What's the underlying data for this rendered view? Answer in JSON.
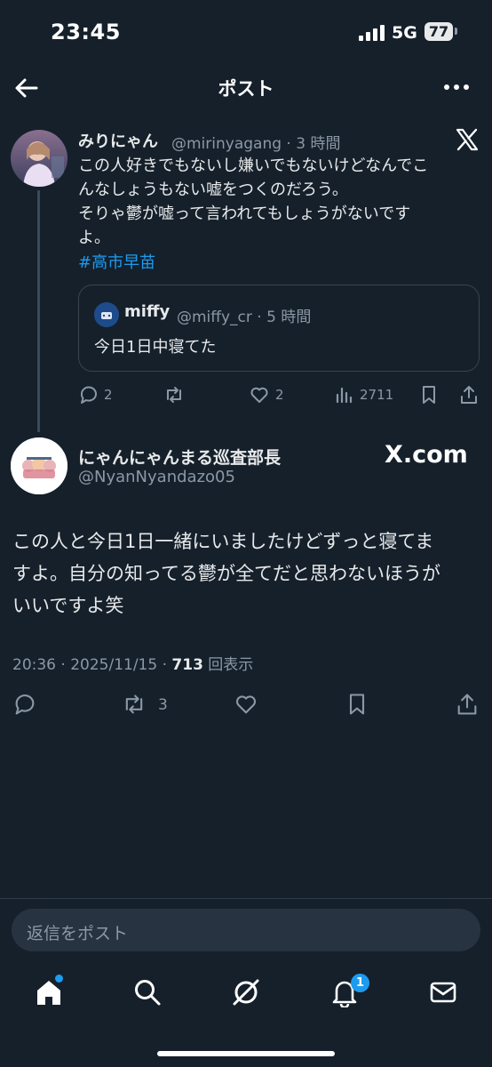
{
  "status_bar": {
    "time": "23:45",
    "network": "5G",
    "battery": "77"
  },
  "header": {
    "title": "ポスト"
  },
  "parent_tweet": {
    "name": "みりにゃん",
    "handle_time": "@mirinyagang · 3 時間",
    "text_lines": [
      "この人好きでもないし嫌いでもないけどなんでこ",
      "んなしょうもない嘘をつくのだろう。",
      "そりゃ鬱が嘘って言われてもしょうがないです",
      "よ。"
    ],
    "hashtag": "#高市早苗",
    "quote": {
      "name": "miffy",
      "handle_time": "@miffy_cr · 5 時間",
      "text": "今日1日中寝てた"
    },
    "actions": {
      "replies": "2",
      "retweets": "",
      "likes": "2",
      "views": "2711"
    }
  },
  "main_tweet": {
    "name": "にゃんにゃんまる巡査部長",
    "handle": "@NyanNyandazo05",
    "watermark": "X.com",
    "text_lines": [
      "この人と今日1日一緒にいましたけどずっと寝てま",
      "すよ。自分の知ってる鬱が全てだと思わないほうが",
      "いいですよ笑"
    ],
    "meta": {
      "datetime": "20:36 · 2025/11/15 · ",
      "views": "713",
      "views_label": " 回表示"
    },
    "actions": {
      "retweets": "3"
    }
  },
  "reply": {
    "placeholder": "返信をポスト"
  },
  "bottom_nav": {
    "items": [
      "home-icon",
      "search-icon",
      "grok-icon",
      "notifications-icon",
      "messages-icon"
    ],
    "notification_count": "1"
  },
  "colors": {
    "background": "#15202b",
    "accent": "#1d9bf0",
    "muted": "#8b98a5",
    "text": "#e7e9ea"
  }
}
